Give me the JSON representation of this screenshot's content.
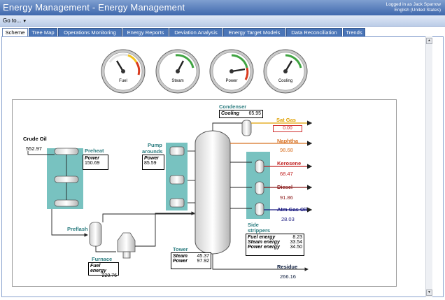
{
  "header": {
    "title": "Energy Management - Energy Management",
    "login_line1": "Logged in as Jack Sparrow",
    "login_line2": "English (United States)"
  },
  "menu": {
    "goto_label": "Go to..."
  },
  "tabs": [
    {
      "label": "Scheme",
      "active": true
    },
    {
      "label": "Tree Map"
    },
    {
      "label": "Operations Monitoring"
    },
    {
      "label": "Energy Reports"
    },
    {
      "label": "Deviation Analysis"
    },
    {
      "label": "Energy Target Models"
    },
    {
      "label": "Data Reconciliation"
    },
    {
      "label": "Trends"
    }
  ],
  "gauges": [
    {
      "label": "Fuel",
      "ticks": [
        "160",
        "180",
        "200",
        "220",
        "240",
        "260",
        "280",
        "300",
        "320"
      ]
    },
    {
      "label": "Steam"
    },
    {
      "label": "Power",
      "ticks": [
        "100",
        "150",
        "200",
        "250",
        "300",
        "350",
        "400",
        "450",
        "500"
      ]
    },
    {
      "label": "Cooling"
    }
  ],
  "scheme": {
    "crude_oil": {
      "label": "Crude Oil",
      "value": "552.97"
    },
    "preheat": {
      "label": "Preheat",
      "field": "Power",
      "value": "150.69"
    },
    "pumparounds": {
      "label1": "Pump",
      "label2": "arounds",
      "field": "Power",
      "value": "85.59"
    },
    "preflash": {
      "label": "Preflash"
    },
    "furnace": {
      "label": "Furnace",
      "field": "Fuel energy",
      "value": "220.76"
    },
    "tower": {
      "label": "Tower",
      "steam_label": "Steam",
      "steam_value": "45.37",
      "power_label": "Power",
      "power_value": "97.92"
    },
    "condenser": {
      "label": "Condenser",
      "field": "Cooling",
      "value": "65.95"
    },
    "side_strippers": {
      "label1": "Side",
      "label2": "strippers",
      "rows": [
        {
          "field": "Fuel energy",
          "value": "8.23"
        },
        {
          "field": "Steam energy",
          "value": "33.54"
        },
        {
          "field": "Power energy",
          "value": "34.50"
        }
      ]
    },
    "products": [
      {
        "name": "Sat Gas",
        "value": "0.00",
        "color": "#e0a000"
      },
      {
        "name": "Naphtha",
        "value": "98.68",
        "color": "#d87020"
      },
      {
        "name": "Kerosene",
        "value": "68.47",
        "color": "#c02020"
      },
      {
        "name": "Diesel",
        "value": "91.86",
        "color": "#8a1a1a"
      },
      {
        "name": "Atm Gas Oil",
        "value": "28.03",
        "color": "#1a1a80"
      },
      {
        "name": "Residue",
        "value": "266.16",
        "color": "#102040"
      }
    ]
  }
}
